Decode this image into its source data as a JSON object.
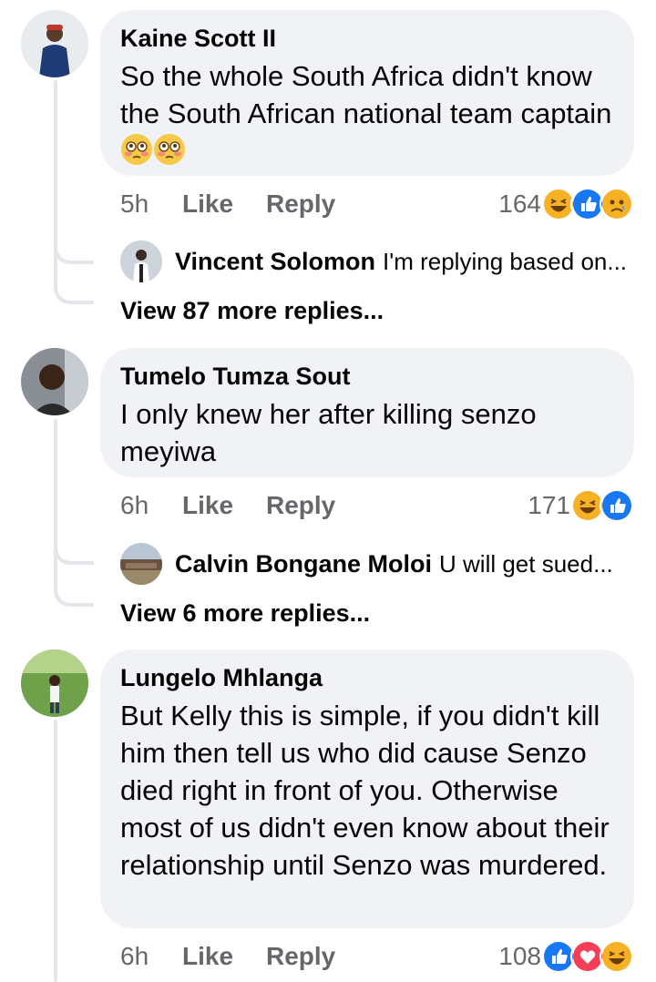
{
  "comments": [
    {
      "author": "Kaine Scott II",
      "text": "So the whole South Africa didn't know the South African national team captain",
      "time": "5h",
      "like": "Like",
      "reply": "Reply",
      "reaction_count": "164",
      "reactions": [
        "haha",
        "like",
        "sad"
      ],
      "preview_reply": {
        "author": "Vincent Solomon",
        "text": "I'm replying based on..."
      },
      "more_replies": "View 87 more replies..."
    },
    {
      "author": "Tumelo Tumza Sout",
      "text": "I only knew her after killing senzo meyiwa",
      "time": "6h",
      "like": "Like",
      "reply": "Reply",
      "reaction_count": "171",
      "reactions": [
        "haha",
        "like"
      ],
      "preview_reply": {
        "author": "Calvin Bongane Moloi",
        "text": "U will get sued..."
      },
      "more_replies": "View 6 more replies..."
    },
    {
      "author": "Lungelo Mhlanga",
      "text": "But Kelly this is simple, if you didn't kill him then tell us who did cause Senzo died right in front of you. Otherwise most of us didn't even know about their relationship until Senzo was murdered.",
      "time": "6h",
      "like": "Like",
      "reply": "Reply",
      "reaction_count": "108",
      "reactions": [
        "like",
        "love",
        "haha"
      ]
    }
  ],
  "colors": {
    "bubble": "#f0f2f5",
    "meta_text": "#65676b",
    "like_blue": "#1877f2",
    "love_red": "#f33e58",
    "emoji_yellow": "#f7b125"
  }
}
